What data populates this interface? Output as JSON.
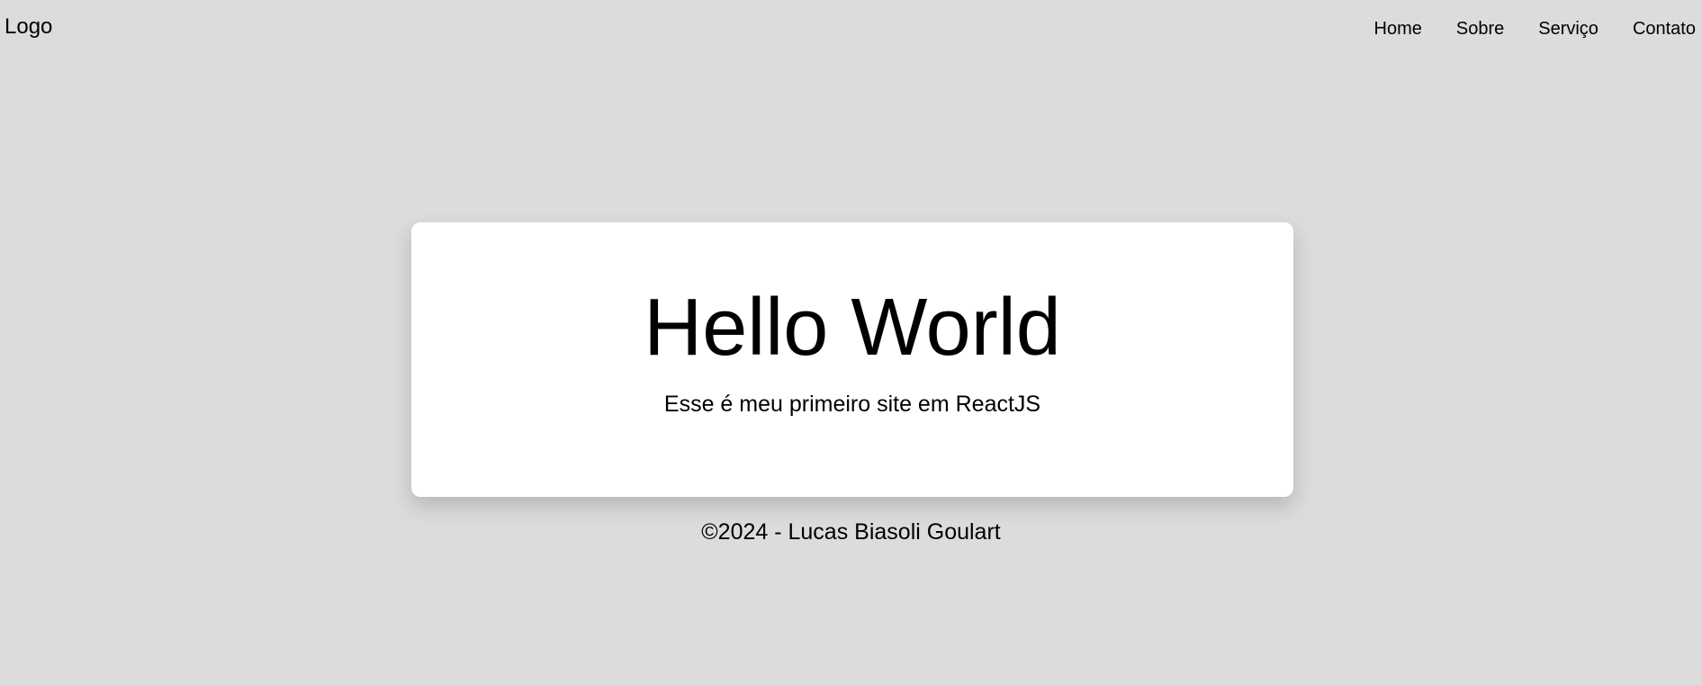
{
  "header": {
    "logo": "Logo",
    "nav": [
      {
        "label": "Home"
      },
      {
        "label": "Sobre"
      },
      {
        "label": "Serviço"
      },
      {
        "label": "Contato"
      }
    ]
  },
  "hero": {
    "title": "Hello World",
    "subtitle": "Esse é meu primeiro site em ReactJS"
  },
  "footer": {
    "text": "©2024 - Lucas Biasoli Goulart"
  },
  "colors": {
    "page_background": "#dcdcdc",
    "card_background": "#ffffff",
    "text": "#000000"
  }
}
